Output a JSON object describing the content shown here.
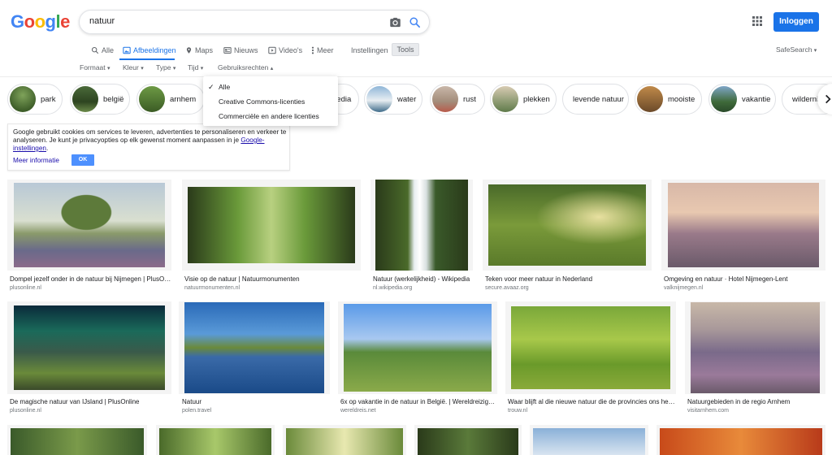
{
  "header": {
    "logo_letters": [
      "G",
      "o",
      "o",
      "g",
      "l",
      "e"
    ],
    "logo_colors": [
      "#4285f4",
      "#ea4335",
      "#fbbc05",
      "#4285f4",
      "#34a853",
      "#ea4335"
    ],
    "search_query": "natuur",
    "signin_label": "Inloggen"
  },
  "nav": {
    "tabs": [
      {
        "label": "Alle",
        "icon": "search-icon"
      },
      {
        "label": "Afbeeldingen",
        "icon": "image-icon",
        "active": true
      },
      {
        "label": "Maps",
        "icon": "map-pin-icon"
      },
      {
        "label": "Nieuws",
        "icon": "news-icon"
      },
      {
        "label": "Video's",
        "icon": "video-icon"
      },
      {
        "label": "Meer",
        "icon": "more-vertical-icon"
      }
    ],
    "settings_label": "Instellingen",
    "tools_label": "Tools",
    "safesearch_label": "SafeSearch"
  },
  "filters": [
    "Formaat",
    "Kleur",
    "Type",
    "Tijd",
    "Gebruiksrechten"
  ],
  "rights_dropdown": {
    "options": [
      "Alle",
      "Creative Commons-licenties",
      "Commerciële en andere licenties"
    ],
    "selected": "Alle"
  },
  "chips": [
    {
      "label": "park"
    },
    {
      "label": "belgië"
    },
    {
      "label": "arnhem"
    },
    {
      "label": "pedia"
    },
    {
      "label": "water"
    },
    {
      "label": "rust"
    },
    {
      "label": "plekken"
    },
    {
      "label": "levende natuur"
    },
    {
      "label": "mooiste"
    },
    {
      "label": "vakantie"
    },
    {
      "label": "wilderni"
    }
  ],
  "cookie": {
    "message_start": "Google gebruikt cookies om services te leveren, advertenties te personaliseren en verkeer te analyseren. Je kunt je privacyopties op elk gewenst moment aanpassen in je ",
    "link": "Google-instellingen",
    "message_end": ".",
    "more_label": "Meer informatie",
    "ok_label": "OK"
  },
  "results": [
    {
      "caption": "Dompel jezelf onder in de natuur bij Nijmegen | PlusOnli...",
      "source": "plusonline.nl"
    },
    {
      "caption": "Visie op de natuur | Natuurmonumenten",
      "source": "natuurmonumenten.nl"
    },
    {
      "caption": "Natuur (werkelijkheid) - Wikipedia",
      "source": "nl.wikipedia.org"
    },
    {
      "caption": "Teken voor meer natuur in Nederland",
      "source": "secure.avaaz.org"
    },
    {
      "caption": "Omgeving en natuur · Hotel Nijmegen-Lent",
      "source": "valknijmegen.nl"
    },
    {
      "caption": "De magische natuur van IJsland | PlusOnline",
      "source": "plusonline.nl"
    },
    {
      "caption": "Natuur",
      "source": "polen.travel"
    },
    {
      "caption": "6x op vakantie in de natuur in België. | Wereldreiziger...",
      "source": "wereldreis.net"
    },
    {
      "caption": "Waar blijft al die nieuwe natuur die de provincies ons heb...",
      "source": "trouw.nl"
    },
    {
      "caption": "Natuurgebieden in de regio Arnhem",
      "source": "visitarnhem.com"
    }
  ],
  "colors": {
    "accent": "#1a73e8",
    "link": "#1a0dab"
  }
}
